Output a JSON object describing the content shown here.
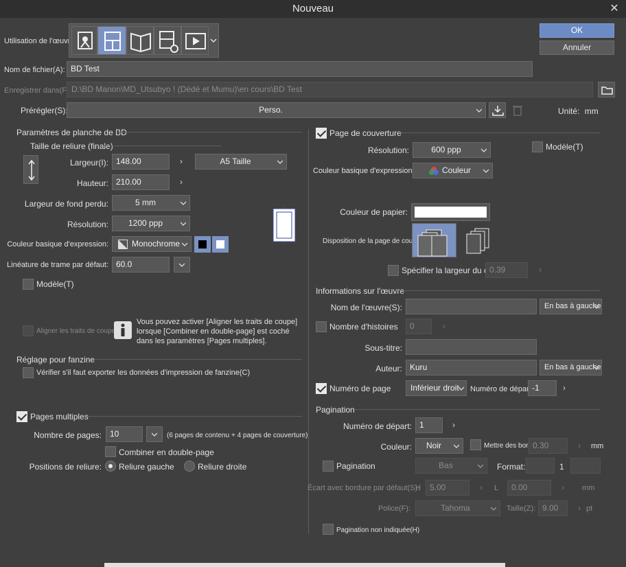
{
  "dialog": {
    "title": "Nouveau",
    "ok_label": "OK",
    "cancel_label": "Annuler"
  },
  "top": {
    "usage_label": "Utilisation de l'œuvre:",
    "usage_icons": [
      "illustration-icon",
      "comic-icon",
      "book-icon",
      "settings-page-icon",
      "animation-icon"
    ],
    "filename_label": "Nom de fichier(A):",
    "filename_value": "BD Test",
    "save_label": "Enregistrer dans(F):",
    "save_path": "D:\\BD Manon\\MD_Utsubyo ! (Dédé et Mumu)\\en cours\\BD Test",
    "preset_label": "Prérégler(S):",
    "preset_value": "Perso.",
    "unit_label": "Unité:",
    "unit_value": "mm"
  },
  "left": {
    "section_title": "Paramètres de planche de BD",
    "binding_title": "Taille de reliure (finale)",
    "width_label": "Largeur(I):",
    "width_value": "148.00",
    "size_preset": "A5 Taille",
    "height_label": "Hauteur:",
    "height_value": "210.00",
    "bleed_label": "Largeur de fond perdu:",
    "bleed_value": "5 mm",
    "resolution_label": "Résolution:",
    "resolution_value": "1200 ppp",
    "color_label": "Couleur basique d'expression:",
    "color_value": "Monochrome",
    "screentone_label": "Linéature de trame par défaut:",
    "screentone_value": "60.0",
    "template_label": "Modèle(T)",
    "align_label": "Aligner les traits de coupe(M)",
    "info_text_1": "Vous pouvez activer [Aligner les traits de coupe]",
    "info_text_2": "lorsque [Combiner en double-page] est coché",
    "info_text_3": "dans les paramètres [Pages multiples].",
    "fanzine_title": "Réglage pour fanzine",
    "fanzine_check": "Vérifier s'il faut exporter les données d'impression de fanzine(C)",
    "multi_title": "Pages multiples",
    "pages_label": "Nombre de pages:",
    "pages_value": "10",
    "pages_note": "(6 pages de contenu + 4 pages de couverture)",
    "combine_label": "Combiner en double-page",
    "binding_pos_label": "Positions de reliure:",
    "binding_left": "Reliure gauche",
    "binding_right": "Reliure droite"
  },
  "right": {
    "cover_title": "Page de couverture",
    "cover_resolution_label": "Résolution:",
    "cover_resolution_value": "600 ppp",
    "cover_template_label": "Modèle(T)",
    "cover_color_label": "Couleur basique d'expression:",
    "cover_color_value": "Couleur",
    "paper_color_label": "Couleur de papier:",
    "layout_label": "Disposition de la page de couvert...",
    "spine_label": "Spécifier la largeur du dos",
    "spine_value": "0.39",
    "info_title": "Informations sur l'œuvre",
    "work_name_label": "Nom de l'œuvre(S):",
    "work_name_pos": "En bas à gauche",
    "stories_label": "Nombre d'histoires",
    "stories_value": "0",
    "subtitle_label": "Sous-titre:",
    "author_label": "Auteur:",
    "author_value": "Kuru",
    "author_pos": "En bas à gauche",
    "page_number_label": "Numéro de page",
    "page_number_pos": "Inférieur droit",
    "start_number_label": "Numéro de départ:",
    "start_number_value": "-1",
    "pagination_title": "Pagination",
    "pag_start_label": "Numéro de départ:",
    "pag_start_value": "1",
    "pag_color_label": "Couleur:",
    "pag_color_value": "Noir",
    "edges_label": "Mettre des bords",
    "edges_value": "0.30",
    "edges_unit": "mm",
    "pagination_check": "Pagination",
    "pagination_pos": "Bas",
    "format_label": "Format:",
    "format_value": "1",
    "gap_label": "Écart avec bordure par défaut(S):",
    "gap_h_label": "H",
    "gap_h_value": "5.00",
    "gap_l_label": "L",
    "gap_l_value": "0.00",
    "gap_unit": "mm",
    "font_label": "Police(F):",
    "font_value": "Tahoma",
    "size_label": "Taille(Z):",
    "size_value": "9.00",
    "size_unit": "pt",
    "hidden_pagination": "Pagination non indiquée(H)"
  },
  "colors": {
    "accent": "#6c8ac4",
    "background": "#3f3f3f",
    "field": "#565656"
  }
}
